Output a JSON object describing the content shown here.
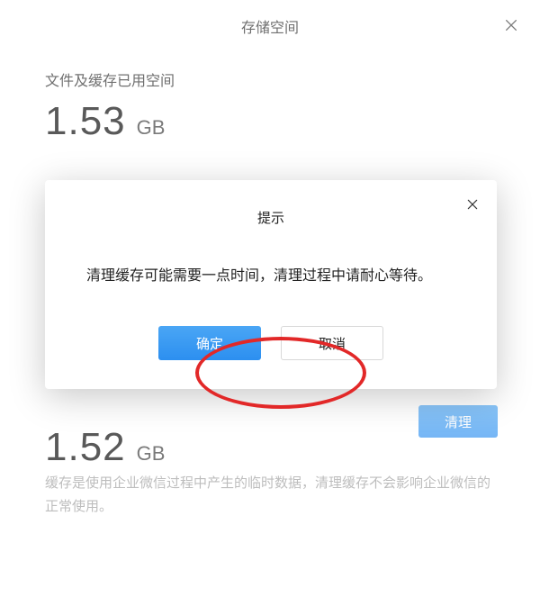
{
  "header": {
    "title": "存储空间"
  },
  "storage": {
    "files_cache": {
      "label": "文件及缓存已用空间",
      "value": "1.53",
      "unit": "GB"
    },
    "cache_only": {
      "value": "1.52",
      "unit": "GB",
      "desc": "缓存是使用企业微信过程中产生的临时数据，清理缓存不会影响企业微信的正常使用。"
    }
  },
  "buttons": {
    "clear_partial": "清理"
  },
  "modal": {
    "title": "提示",
    "message": "清理缓存可能需要一点时间，清理过程中请耐心等待。",
    "ok": "确定",
    "cancel": "取消"
  }
}
